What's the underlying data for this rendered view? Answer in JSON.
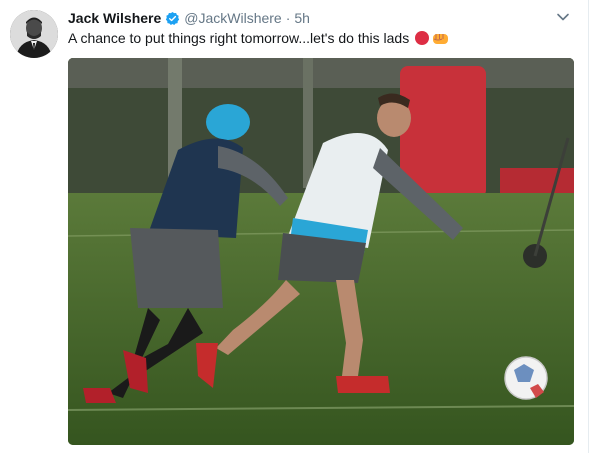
{
  "tweet": {
    "author_name": "Jack Wilshere",
    "handle": "@JackWilshere",
    "separator": "·",
    "time": "5h",
    "text": "A chance to put things right tomorrow...let's do this lads",
    "emojis": [
      "red-circle",
      "oncoming-fist"
    ]
  },
  "colors": {
    "text": "#14171a",
    "secondary": "#657786",
    "verified": "#1da1f2",
    "red_circle": "#dd2e44",
    "fist": "#ffac33"
  }
}
